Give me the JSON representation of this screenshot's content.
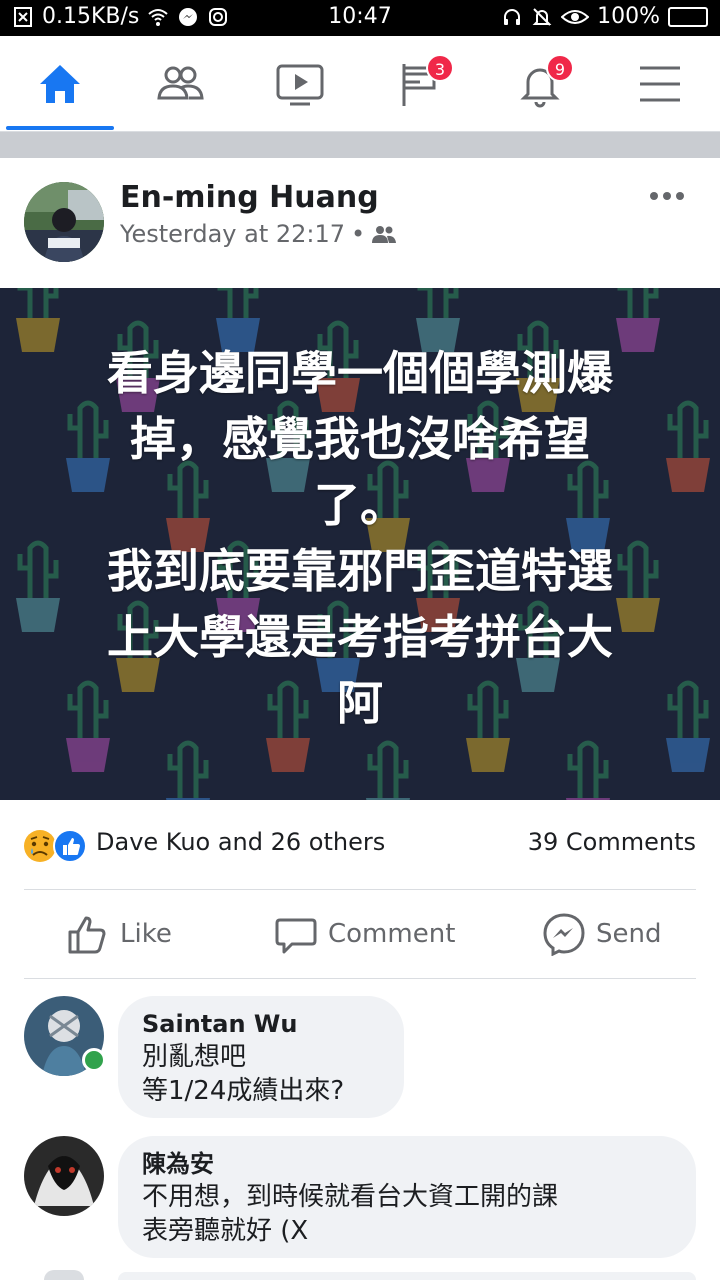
{
  "status_bar": {
    "network_speed": "0.15KB/s",
    "time": "10:47",
    "battery": "100%",
    "battery_level": 1.0
  },
  "nav": {
    "items": [
      "home-icon",
      "friends-icon",
      "watch-icon",
      "pages-icon",
      "notifications-icon",
      "menu-icon"
    ],
    "pages_badge": "3",
    "notifications_badge": "9",
    "accent": "#1877f2"
  },
  "post": {
    "author": "En-ming Huang",
    "timestamp": "Yesterday at 22:17",
    "separator": "•",
    "body": "看身邊同學一個個學測爆\n掉，感覺我也沒啥希望\n了。\n我到底要靠邪門歪道特選\n上大學還是考指考拼台大\n阿",
    "background_color": "#1d2438"
  },
  "reactions": {
    "summary": "Dave Kuo and 26 others",
    "comments": "39 Comments"
  },
  "actions": {
    "like": "Like",
    "comment": "Comment",
    "send": "Send"
  },
  "comments": [
    {
      "name": "Saintan Wu",
      "text": "別亂想吧\n等1/24成績出來?"
    },
    {
      "name": "陳為安",
      "text": "不用想，到時候就看台大資工開的課\n表旁聽就好 (X"
    }
  ]
}
